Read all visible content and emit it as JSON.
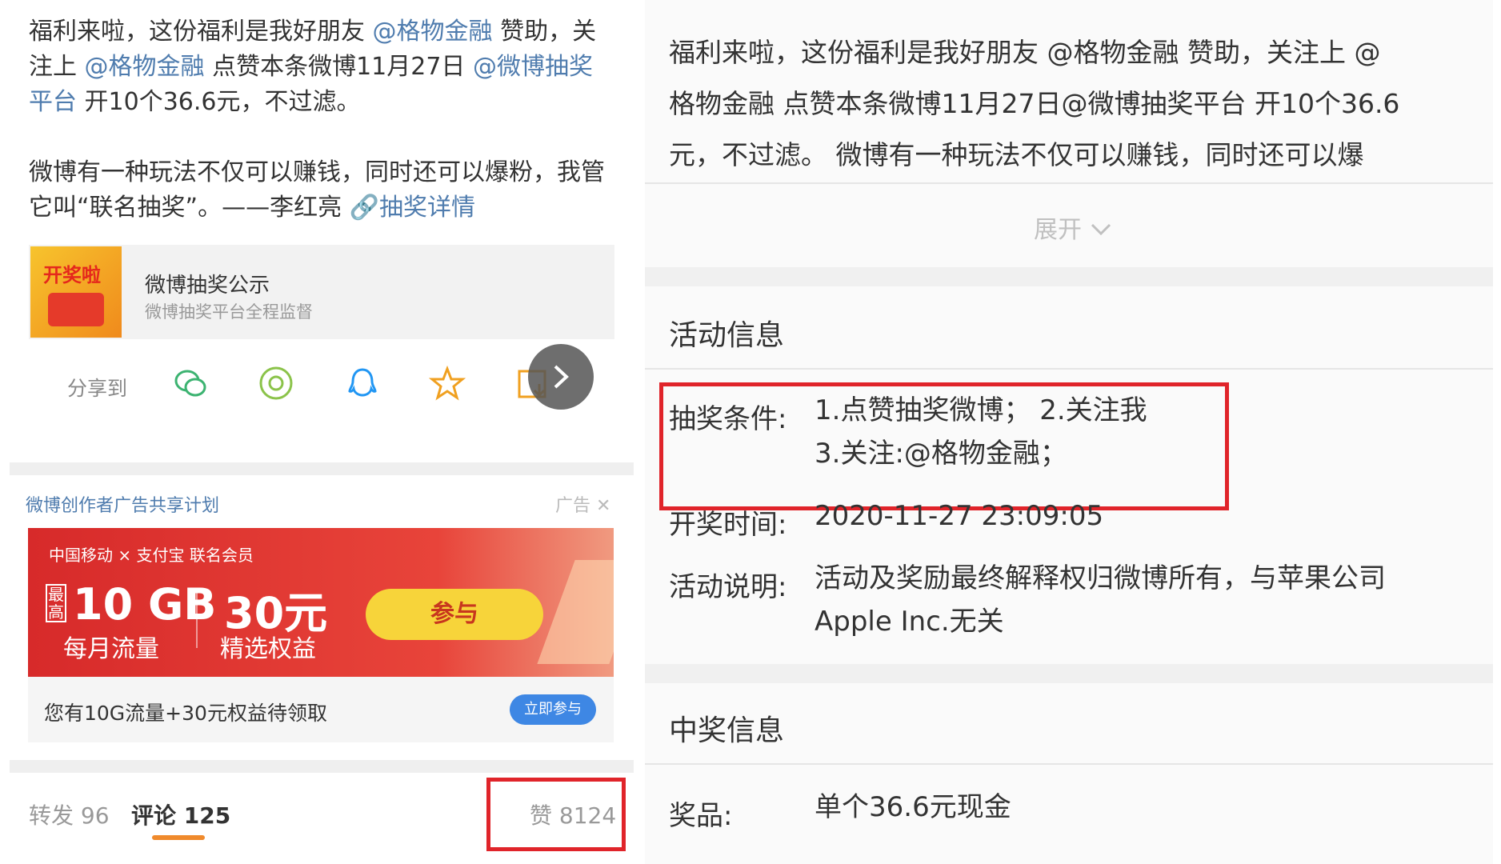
{
  "left": {
    "post": {
      "line1_prefix": "福利来啦，这份福利是我好朋友 ",
      "mention1": "@格物金融",
      "line1_mid": " 赞助，关注上 ",
      "mention2": "@格物金融",
      "line1_mid2": " 点赞本条微博11月27日 ",
      "mention3": "@微博抽奖平台",
      "line1_end": " 开10个36.6元，不过滤。",
      "para2": "微博有一种玩法不仅可以赚钱，同时还可以爆粉，我管它叫“联名抽奖”。——李红亮 ",
      "link": "🔗抽奖详情"
    },
    "card": {
      "thumb_badge": "开奖啦",
      "title": "微博抽奖公示",
      "subtitle": "微博抽奖平台全程监督"
    },
    "share": {
      "label": "分享到",
      "icons": [
        "wechat-icon",
        "moments-icon",
        "qq-icon",
        "favorite-icon",
        "save-image-icon"
      ]
    },
    "ad": {
      "header": "微博创作者广告共享计划",
      "tag": "广告",
      "brand": "中国移动 × 支付宝 联名会员",
      "max_label": "最高",
      "gb": "10 GB",
      "gb_sub": "每月流量",
      "yuan": "30元",
      "yuan_sub": "精选权益",
      "join_label": "参与",
      "footer_text": "您有10G流量+30元权益待领取",
      "footer_button": "立即参与"
    },
    "tabs": {
      "repost": "转发 96",
      "comment": "评论 125",
      "like": "赞 8124"
    }
  },
  "right": {
    "intro_line1": "福利来啦，这份福利是我好朋友 @格物金融 赞助，关注上 @",
    "intro_line2": "格物金融 点赞本条微博11月27日@微博抽奖平台 开10个36.6",
    "intro_line3": "元，不过滤。 微博有一种玩法不仅可以赚钱，同时还可以爆",
    "expand": "展开",
    "activity_title": "活动信息",
    "cond_label": "抽奖条件:",
    "cond_line1": "1.点赞抽奖微博；  2.关注我",
    "cond_line2": "3.关注:@格物金融；",
    "time_label": "开奖时间:",
    "time_value": "2020-11-27 23:09:05",
    "desc_label": "活动说明:",
    "desc_line1": "活动及奖励最终解释权归微博所有，与苹果公司",
    "desc_line2": "Apple Inc.无关",
    "prize_title": "中奖信息",
    "prize_label": "奖品:",
    "prize_value": "单个36.6元现金"
  },
  "colors": {
    "mention": "#4f7cae",
    "highlight_box": "#e0242a",
    "tab_underline": "#f08a2c",
    "ad_red": "#d72a2a",
    "ad_button": "#f7d43a"
  }
}
